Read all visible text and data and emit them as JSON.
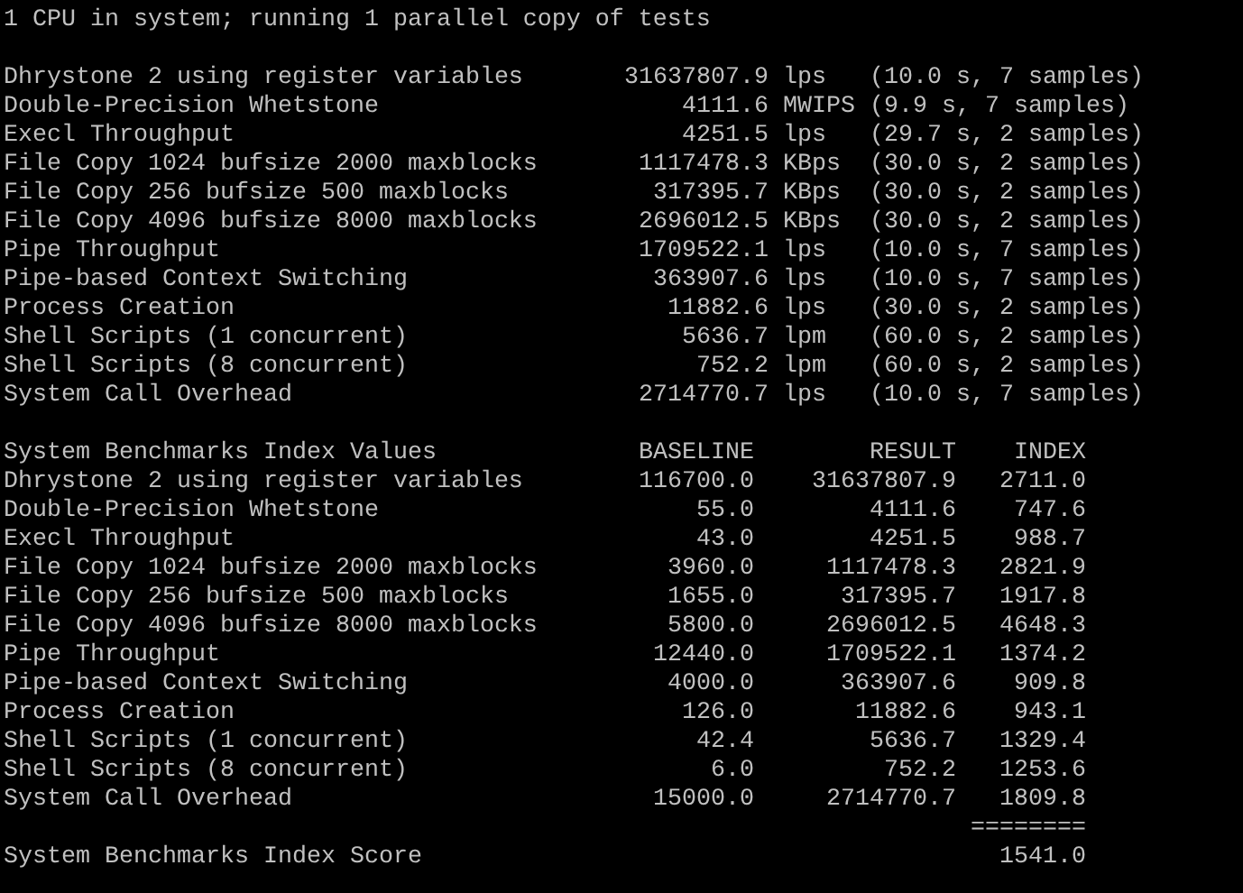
{
  "header": "1 CPU in system; running 1 parallel copy of tests",
  "results": [
    {
      "name": "Dhrystone 2 using register variables",
      "value": "31637807.9",
      "unit": "lps",
      "detail": "(10.0 s, 7 samples)"
    },
    {
      "name": "Double-Precision Whetstone",
      "value": "4111.6",
      "unit": "MWIPS",
      "detail": "(9.9 s, 7 samples)"
    },
    {
      "name": "Execl Throughput",
      "value": "4251.5",
      "unit": "lps",
      "detail": "(29.7 s, 2 samples)"
    },
    {
      "name": "File Copy 1024 bufsize 2000 maxblocks",
      "value": "1117478.3",
      "unit": "KBps",
      "detail": "(30.0 s, 2 samples)"
    },
    {
      "name": "File Copy 256 bufsize 500 maxblocks",
      "value": "317395.7",
      "unit": "KBps",
      "detail": "(30.0 s, 2 samples)"
    },
    {
      "name": "File Copy 4096 bufsize 8000 maxblocks",
      "value": "2696012.5",
      "unit": "KBps",
      "detail": "(30.0 s, 2 samples)"
    },
    {
      "name": "Pipe Throughput",
      "value": "1709522.1",
      "unit": "lps",
      "detail": "(10.0 s, 7 samples)"
    },
    {
      "name": "Pipe-based Context Switching",
      "value": "363907.6",
      "unit": "lps",
      "detail": "(10.0 s, 7 samples)"
    },
    {
      "name": "Process Creation",
      "value": "11882.6",
      "unit": "lps",
      "detail": "(30.0 s, 2 samples)"
    },
    {
      "name": "Shell Scripts (1 concurrent)",
      "value": "5636.7",
      "unit": "lpm",
      "detail": "(60.0 s, 2 samples)"
    },
    {
      "name": "Shell Scripts (8 concurrent)",
      "value": "752.2",
      "unit": "lpm",
      "detail": "(60.0 s, 2 samples)"
    },
    {
      "name": "System Call Overhead",
      "value": "2714770.7",
      "unit": "lps",
      "detail": "(10.0 s, 7 samples)"
    }
  ],
  "index_table": {
    "columns": [
      "System Benchmarks Index Values",
      "BASELINE",
      "RESULT",
      "INDEX"
    ],
    "rows": [
      [
        "Dhrystone 2 using register variables",
        "116700.0",
        "31637807.9",
        "2711.0"
      ],
      [
        "Double-Precision Whetstone",
        "55.0",
        "4111.6",
        "747.6"
      ],
      [
        "Execl Throughput",
        "43.0",
        "4251.5",
        "988.7"
      ],
      [
        "File Copy 1024 bufsize 2000 maxblocks",
        "3960.0",
        "1117478.3",
        "2821.9"
      ],
      [
        "File Copy 256 bufsize 500 maxblocks",
        "1655.0",
        "317395.7",
        "1917.8"
      ],
      [
        "File Copy 4096 bufsize 8000 maxblocks",
        "5800.0",
        "2696012.5",
        "4648.3"
      ],
      [
        "Pipe Throughput",
        "12440.0",
        "1709522.1",
        "1374.2"
      ],
      [
        "Pipe-based Context Switching",
        "4000.0",
        "363907.6",
        "909.8"
      ],
      [
        "Process Creation",
        "126.0",
        "11882.6",
        "943.1"
      ],
      [
        "Shell Scripts (1 concurrent)",
        "42.4",
        "5636.7",
        "1329.4"
      ],
      [
        "Shell Scripts (8 concurrent)",
        "6.0",
        "752.2",
        "1253.6"
      ],
      [
        "System Call Overhead",
        "15000.0",
        "2714770.7",
        "1809.8"
      ]
    ],
    "separator": "========",
    "score_label": "System Benchmarks Index Score",
    "score": "1541.0"
  }
}
